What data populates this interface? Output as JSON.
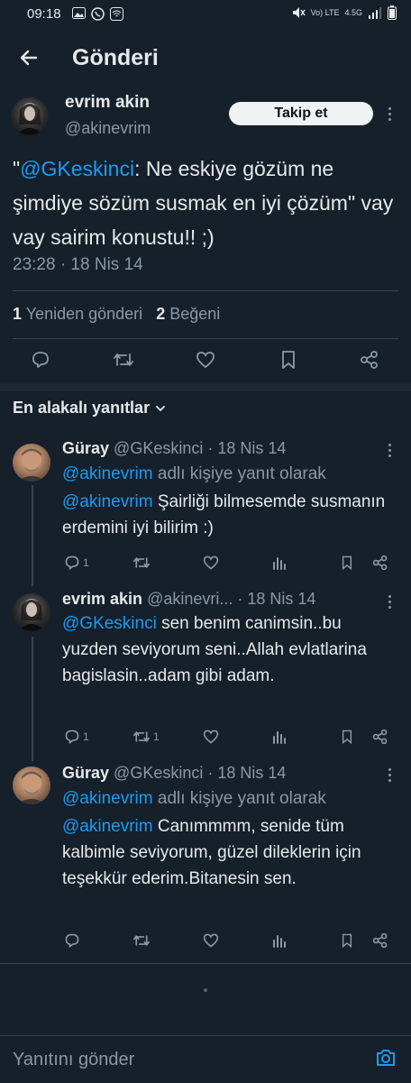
{
  "status_bar": {
    "time": "09:18",
    "network": "4.5G",
    "lte": "Vo) LTE"
  },
  "header": {
    "title": "Gönderi"
  },
  "main_tweet": {
    "name": "evrim akin",
    "handle": "@akinevrim",
    "follow_label": "Takip et",
    "text_quote_open": "\"",
    "mention": "@GKeskinci",
    "text_rest": ": Ne eskiye gözüm ne şimdiye sözüm susmak en iyi çözüm\" vay vay sairim konustu!! ;)",
    "timestamp": "23:28 · 18 Nis 14",
    "retweets_count": "1",
    "retweets_label": "Yeniden gönderi",
    "likes_count": "2",
    "likes_label": "Beğeni"
  },
  "replies_header": {
    "label": "En alakalı yanıtlar"
  },
  "replies": [
    {
      "name": "Güray",
      "handle": "@GKeskinci",
      "time": "· 18 Nis 14",
      "reply_to_mention": "@akinevrim",
      "reply_to_text": " adlı kişiye yanıt olarak",
      "mention": "@akinevrim",
      "text": " Şairliği bilmesemde susmanın erdemini iyi bilirim :)",
      "reply_count": "1",
      "retweet_count": ""
    },
    {
      "name": "evrim akin",
      "handle": "@akinevri...",
      "time": "· 18 Nis 14",
      "mention": "@GKeskinci",
      "text": " sen benim canimsin..bu yuzden seviyorum seni..Allah evlatlarina bagislasin..adam gibi adam.",
      "reply_count": "1",
      "retweet_count": "1"
    },
    {
      "name": "Güray",
      "handle": "@GKeskinci",
      "time": "· 18 Nis 14",
      "reply_to_mention": "@akinevrim",
      "reply_to_text": " adlı kişiye yanıt olarak",
      "mention": "@akinevrim",
      "text": " Canımmmm, senide tüm kalbimle seviyorum, güzel dileklerin için teşekkür ederim.Bitanesin sen.",
      "reply_count": "",
      "retweet_count": ""
    }
  ],
  "composer": {
    "placeholder": "Yanıtını gönder"
  },
  "colors": {
    "background": "#15202b",
    "link": "#1d9bf0",
    "muted": "#8b98a5",
    "divider": "#38444d"
  }
}
